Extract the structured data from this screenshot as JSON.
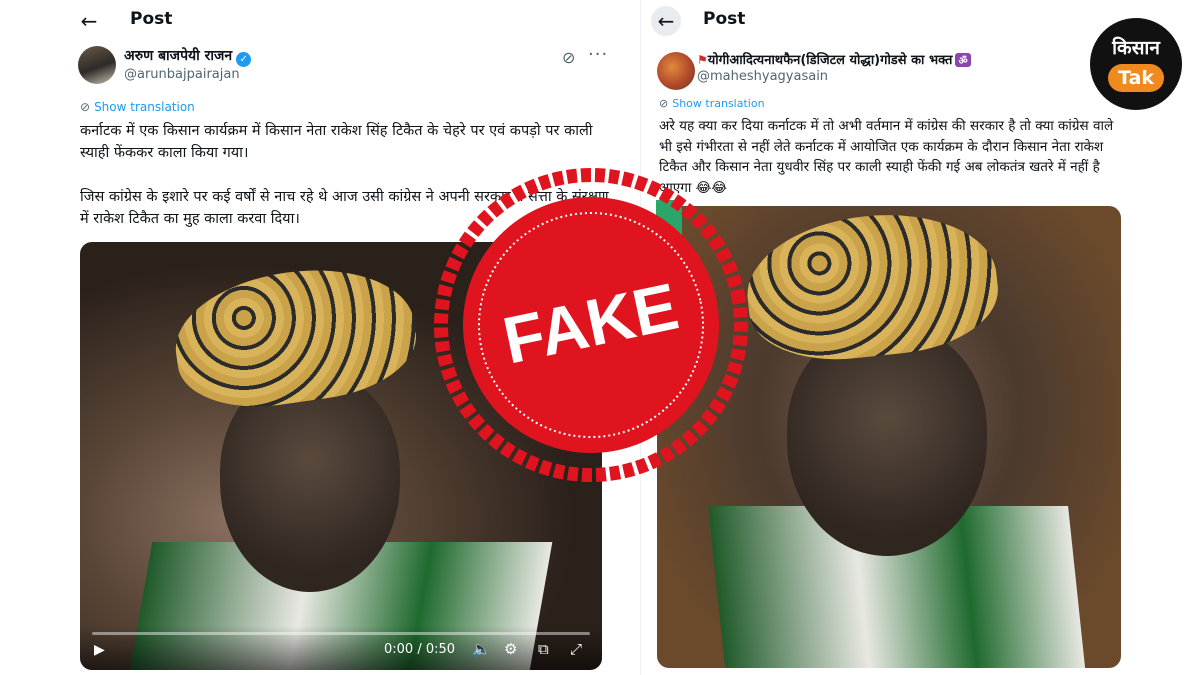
{
  "left_post": {
    "title": "Post",
    "display_name": "अरुण बाजपेयी राजन",
    "handle": "@arunbajpairajan",
    "show_translation": "Show translation",
    "paragraph_1": "कर्नाटक में एक किसान कार्यक्रम में किसान नेता राकेश सिंह टिकैत के चेहरे पर एवं कपड़ो पर काली स्याही फेंककर काला किया गया।",
    "paragraph_2": "जिस कांग्रेस के इशारे पर कई वर्षों से नाच रहे थे आज उसी कांग्रेस ने अपनी सरकार व सत्ता के संरक्षण में राकेश टिकैत का मुह काला करवा दिया।",
    "video": {
      "time": "0:00 / 0:50",
      "progress_fraction": 0.0
    }
  },
  "right_post": {
    "title": "Post",
    "display_name": "योगीआदित्यनाथफैन(डिजिटल योद्धा)गोडसे का भक्त",
    "om_badge": "ॐ",
    "handle": "@maheshyagyasain",
    "show_translation": "Show translation",
    "text": "अरे यह क्या कर दिया कर्नाटक में तो अभी वर्तमान में कांग्रेस की सरकार है तो क्या कांग्रेस वाले भी इसे गंभीरता से नहीं लेते कर्नाटक में आयोजित एक कार्यक्रम के दौरान किसान नेता राकेश टिकैत और किसान नेता युधवीर सिंह पर काली स्याही फेंकी गई अब लोकतंत्र खतरे में नहीं है आएगा 😂😂"
  },
  "stamp": {
    "label": "FAKE",
    "color": "#e0141e"
  },
  "logo": {
    "line1": "किसान",
    "line2": "Tak",
    "accent": "#f08a1f"
  },
  "icons": {
    "back": "arrow-left-icon",
    "grok": "grok-icon",
    "more": "more-dots-icon",
    "verified": "verified-badge-icon",
    "translate": "translate-icon",
    "play": "play-icon",
    "volume": "volume-icon",
    "settings": "settings-gear-icon",
    "pip": "pip-icon",
    "fullscreen": "fullscreen-icon"
  }
}
